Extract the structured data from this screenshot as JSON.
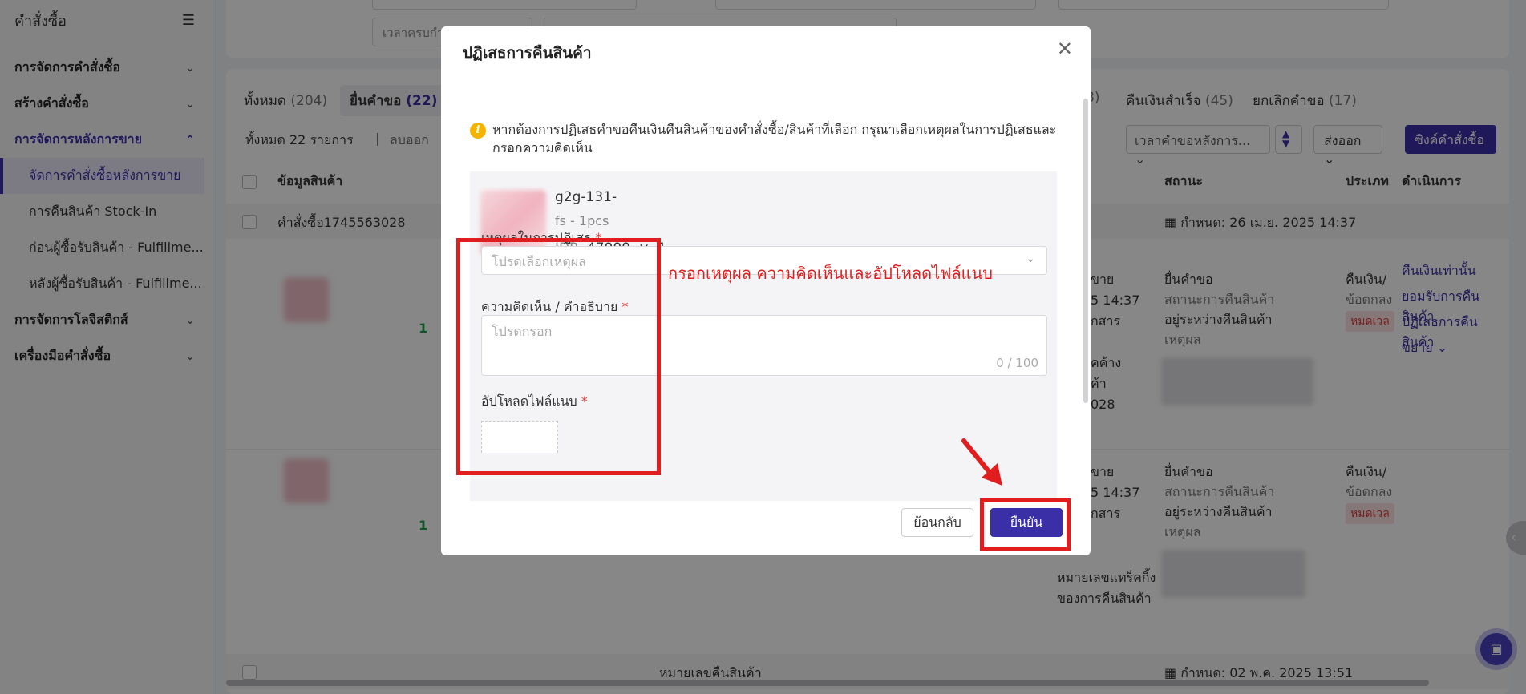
{
  "sidebar": {
    "title": "คำสั่งซื้อ",
    "collapse_icon": "collapse-menu-icon",
    "groups": [
      {
        "label": "การจัดการคำสั่งซื้อ",
        "expanded": false
      },
      {
        "label": "สร้างคำสั่งซื้อ",
        "expanded": false
      },
      {
        "label": "การจัดการหลังการขาย",
        "expanded": true,
        "children": [
          {
            "label": "จัดการคำสั่งซื้อหลังการขาย",
            "active": true
          },
          {
            "label": "การคืนสินค้า Stock-In"
          },
          {
            "label": "ก่อนผู้ซื้อรับสินค้า - Fulfillme..."
          },
          {
            "label": "หลังผู้ซื้อรับสินค้า - Fulfillme..."
          }
        ]
      },
      {
        "label": "การจัดการโลจิสติกส์",
        "expanded": false
      },
      {
        "label": "เครื่องมือคำสั่งซื้อ",
        "expanded": false
      }
    ]
  },
  "filters": {
    "time_select": "เวลาครบกำ"
  },
  "tabs": [
    {
      "label": "ทั้งหมด",
      "count": "(204)"
    },
    {
      "label": "ยื่นคำขอ",
      "count": "(22)",
      "selected": true
    },
    {
      "label": "",
      "count": "8)"
    },
    {
      "label": "คืนเงินสำเร็จ",
      "count": "(45)"
    },
    {
      "label": "ยกเลิกคำขอ",
      "count": "(17)"
    }
  ],
  "toolbar": {
    "total": "ทั้งหมด 22 รายการ",
    "clear": "ลบออก",
    "sort_select": "เวลาคำขอหลังการ...",
    "export": "ส่งออก",
    "sync": "ซิงค์คำสั่งซื้อ"
  },
  "table": {
    "headers": {
      "product": "ข้อมูลสินค้า",
      "status": "สถานะ",
      "type": "ประเภท",
      "action": "ดำเนินการ"
    },
    "order1": {
      "order_no": "คำสั่งซื้อ1745563028",
      "deadline": "กำหนด:  26 เม.ย. 2025 14:37"
    },
    "row1": {
      "qty": "1",
      "mid_lines": [
        "ขาย",
        "5 14:37",
        "กสาร",
        "",
        "คค้าง",
        "ค้า",
        "028"
      ],
      "status_title": "ยื่นคำขอ",
      "status_sub": "สถานะการคืนสินค้า",
      "status_value": "อยู่ระหว่างคืนสินค้า",
      "reason": "เหตุผล",
      "type_title": "คืนเงิน/",
      "type_sub": "ข้อตกลง",
      "type_tag": "หมดเวล",
      "actions": [
        "คืนเงินเท่านั้น",
        "ยอมรับการคืนสินค้า",
        "ปฏิเสธการคืนสินค้า",
        "ขยาย"
      ]
    },
    "row2": {
      "qty": "1",
      "mid_lines": [
        "ขาย",
        "5 14:37",
        "กสาร"
      ],
      "mid_bottom": [
        "หมายเลขแทร็คกิ้ง",
        "ของการคืนสินค้า"
      ],
      "status_title": "ยื่นคำขอ",
      "status_sub": "สถานะการคืนสินค้า",
      "status_value": "อยู่ระหว่างคืนสินค้า",
      "reason": "เหตุผล",
      "type_title": "คืนเงิน/",
      "type_sub": "ข้อตกลง",
      "type_tag": "หมดเวล"
    },
    "order3": {
      "return_no": "หมายเลขคืนสินค้า",
      "deadline": "กำหนด:  02 พ.ค. 2025 13:51"
    }
  },
  "modal": {
    "title": "ปฏิเสธการคืนสินค้า",
    "info": "หากต้องการปฏิเสธคำขอคืนเงินคืนสินค้าของคำสั่งซื้อ/สินค้าที่เลือก กรุณาเลือกเหตุผลในการปฏิเสธและกรอกความคิดเห็น",
    "product": {
      "name": "g2g-131-",
      "variant": "fs - 1pcs",
      "currency": "IDR",
      "price": "47000",
      "times": "×",
      "qty": "1"
    },
    "reason_label": "เหตุผลในการปฏิเสธ",
    "reason_placeholder": "โปรดเลือกเหตุผล",
    "comment_label": "ความคิดเห็น / คำอธิบาย",
    "comment_placeholder": "โปรดกรอก",
    "comment_counter": "0  /  100",
    "upload_label": "อัปโหลดไฟล์แนบ",
    "required_mark": "*",
    "back_button": "ย้อนกลับ",
    "confirm_button": "ยืนยัน"
  },
  "annotation": {
    "text": "กรอกเหตุผล ความคิดเห็นและอัปโหลดไฟล์แนบ",
    "color": "#e11d1d"
  },
  "colors": {
    "primary": "#3b2fa8",
    "annotation": "#e11d1d",
    "overlay": "rgba(0,0,0,0.47)"
  }
}
